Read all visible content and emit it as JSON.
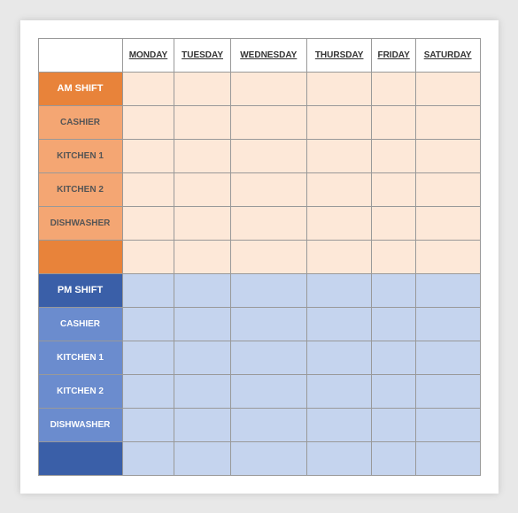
{
  "header": {
    "corner": "",
    "columns": [
      "MONDAY",
      "TUESDAY",
      "WEDNESDAY",
      "THURSDAY",
      "FRIDAY",
      "SATURDAY"
    ]
  },
  "am_shift": {
    "shift_label": "AM SHIFT",
    "rows": [
      {
        "label": "CASHIER"
      },
      {
        "label": "KITCHEN 1"
      },
      {
        "label": "KITCHEN 2"
      },
      {
        "label": "DISHWASHER"
      },
      {
        "label": ""
      }
    ]
  },
  "pm_shift": {
    "shift_label": "PM SHIFT",
    "rows": [
      {
        "label": "CASHIER"
      },
      {
        "label": "KITCHEN 1"
      },
      {
        "label": "KITCHEN 2"
      },
      {
        "label": "DISHWASHER"
      },
      {
        "label": ""
      }
    ]
  }
}
